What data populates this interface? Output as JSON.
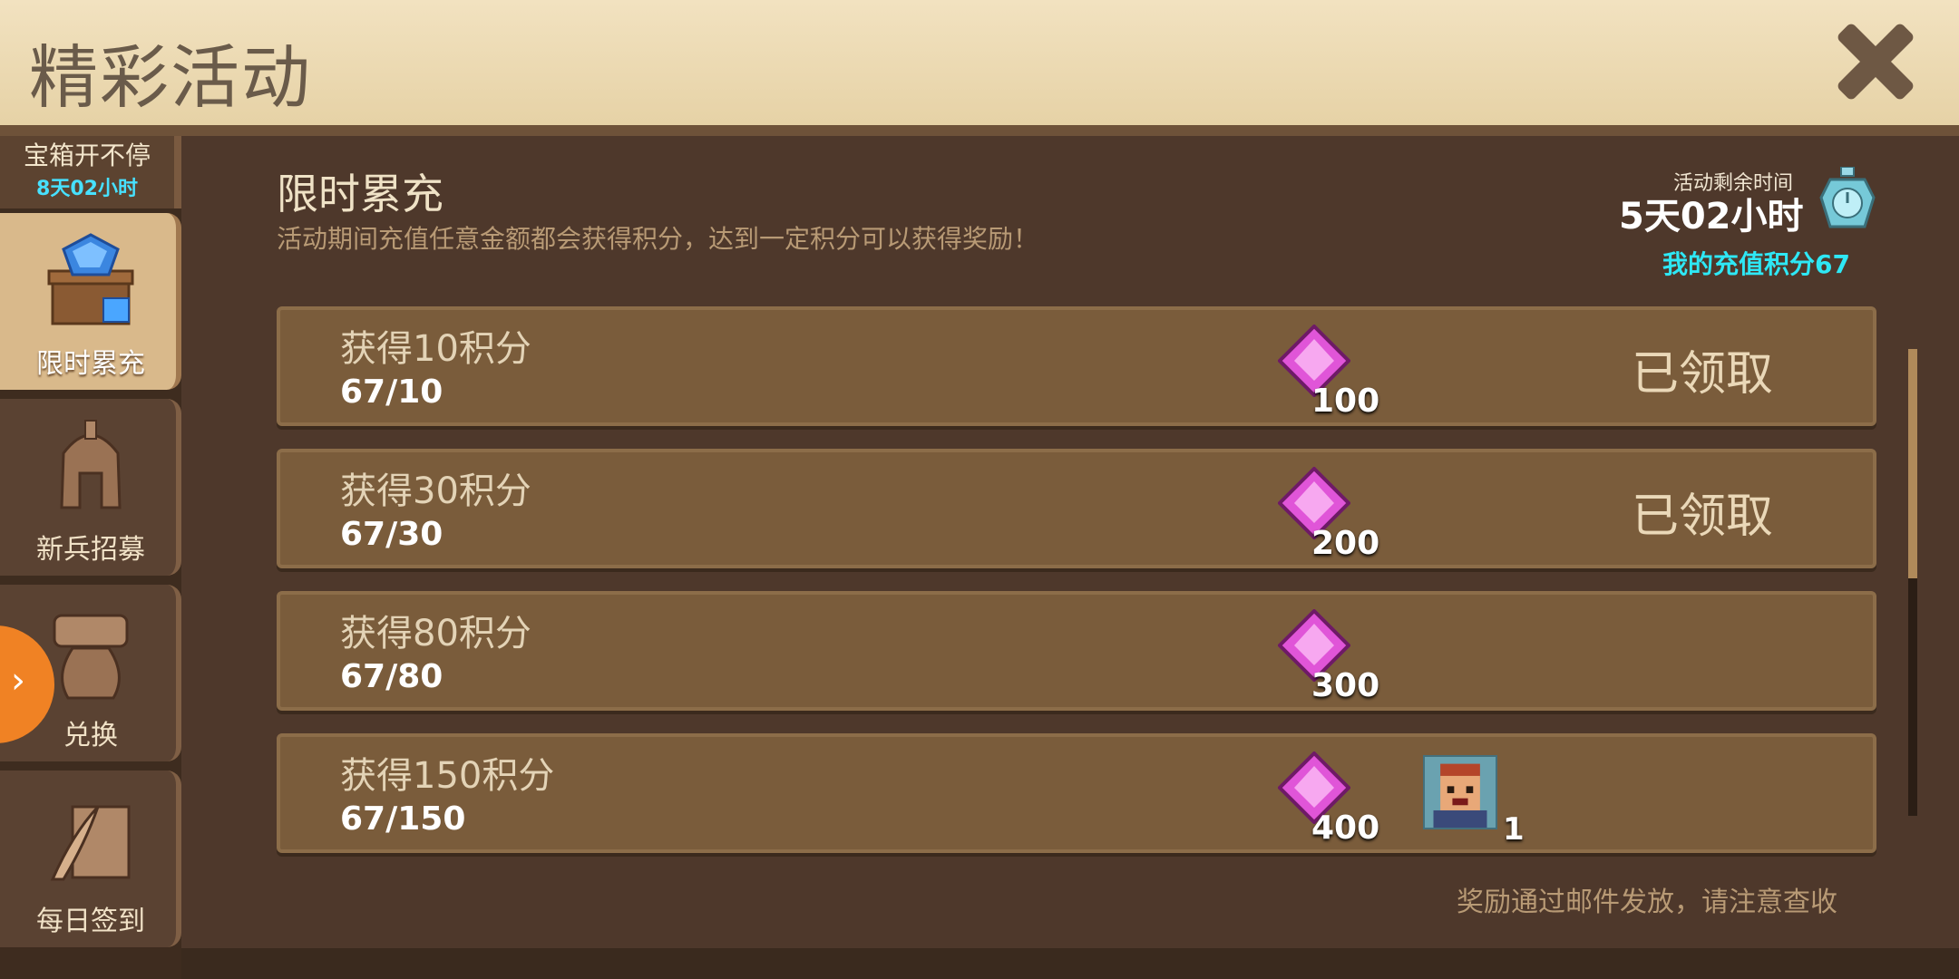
{
  "header": {
    "title": "精彩活动"
  },
  "sidebar": {
    "top_label": "宝箱开不停",
    "top_timer": "8天02小时",
    "tabs": [
      {
        "label": "限时累充",
        "icon": "gem-chest-icon"
      },
      {
        "label": "新兵招募",
        "icon": "helmet-icon"
      },
      {
        "label": "兑换",
        "icon": "exchange-sack-icon"
      },
      {
        "label": "每日签到",
        "icon": "quill-scroll-icon"
      }
    ]
  },
  "activity": {
    "title": "限时累充",
    "description": "活动期间充值任意金额都会获得积分，达到一定积分可以获得奖励！",
    "timer_label": "活动剩余时间",
    "timer_value": "5天02小时",
    "points_label": "我的充值积分67"
  },
  "rewards": [
    {
      "title": "获得10积分",
      "progress": "67/10",
      "gem_amount": "100",
      "status": "已领取"
    },
    {
      "title": "获得30积分",
      "progress": "67/30",
      "gem_amount": "200",
      "status": "已领取"
    },
    {
      "title": "获得80积分",
      "progress": "67/80",
      "gem_amount": "300",
      "status": ""
    },
    {
      "title": "获得150积分",
      "progress": "67/150",
      "gem_amount": "400",
      "status": "",
      "extra_count": "1"
    }
  ],
  "footnote": "奖励通过邮件发放，请注意查收",
  "colors": {
    "accent_cyan": "#2ee8f5",
    "gem_pink": "#e055d8",
    "side_arrow": "#f08224"
  }
}
